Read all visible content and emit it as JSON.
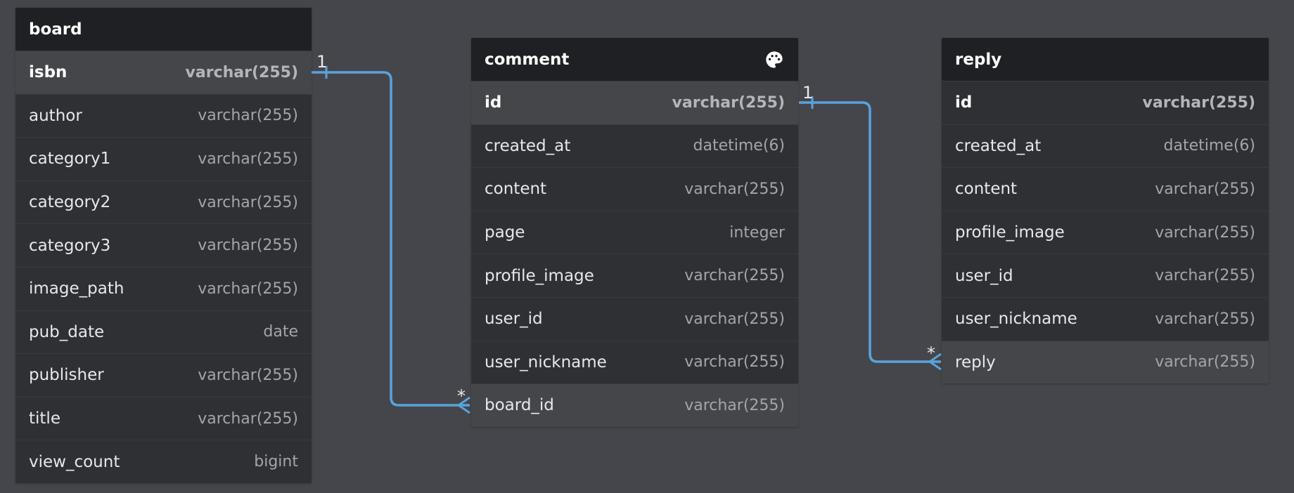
{
  "tables": {
    "board": {
      "name": "board",
      "columns": [
        {
          "name": "isbn",
          "type": "varchar(255)"
        },
        {
          "name": "author",
          "type": "varchar(255)"
        },
        {
          "name": "category1",
          "type": "varchar(255)"
        },
        {
          "name": "category2",
          "type": "varchar(255)"
        },
        {
          "name": "category3",
          "type": "varchar(255)"
        },
        {
          "name": "image_path",
          "type": "varchar(255)"
        },
        {
          "name": "pub_date",
          "type": "date"
        },
        {
          "name": "publisher",
          "type": "varchar(255)"
        },
        {
          "name": "title",
          "type": "varchar(255)"
        },
        {
          "name": "view_count",
          "type": "bigint"
        }
      ]
    },
    "comment": {
      "name": "comment",
      "icon": "palette-icon",
      "columns": [
        {
          "name": "id",
          "type": "varchar(255)"
        },
        {
          "name": "created_at",
          "type": "datetime(6)"
        },
        {
          "name": "content",
          "type": "varchar(255)"
        },
        {
          "name": "page",
          "type": "integer"
        },
        {
          "name": "profile_image",
          "type": "varchar(255)"
        },
        {
          "name": "user_id",
          "type": "varchar(255)"
        },
        {
          "name": "user_nickname",
          "type": "varchar(255)"
        },
        {
          "name": "board_id",
          "type": "varchar(255)"
        }
      ]
    },
    "reply": {
      "name": "reply",
      "columns": [
        {
          "name": "id",
          "type": "varchar(255)"
        },
        {
          "name": "created_at",
          "type": "datetime(6)"
        },
        {
          "name": "content",
          "type": "varchar(255)"
        },
        {
          "name": "profile_image",
          "type": "varchar(255)"
        },
        {
          "name": "user_id",
          "type": "varchar(255)"
        },
        {
          "name": "user_nickname",
          "type": "varchar(255)"
        },
        {
          "name": "reply",
          "type": "varchar(255)"
        }
      ]
    }
  },
  "relations": [
    {
      "from": "board.isbn",
      "to": "comment.board_id",
      "from_label": "1",
      "to_label": "*"
    },
    {
      "from": "comment.id",
      "to": "reply.reply",
      "from_label": "1",
      "to_label": "*"
    }
  ],
  "colors": {
    "background": "#45464b",
    "table_body": "#2f3034",
    "table_header": "#1f2023",
    "key_row": "#45464a",
    "connector": "#5aa3dc"
  }
}
